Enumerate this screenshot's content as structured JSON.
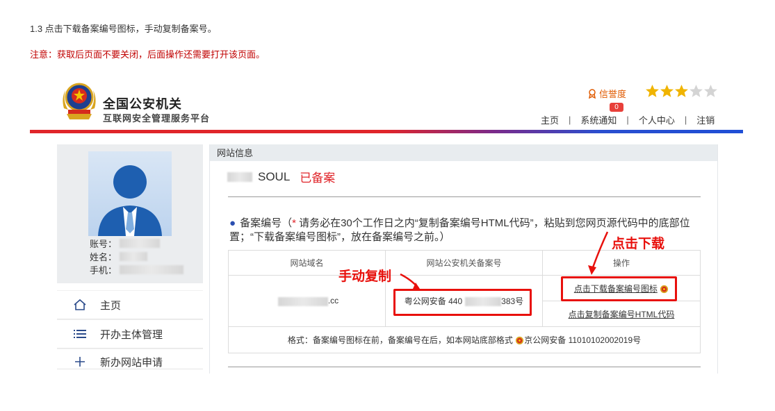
{
  "instructions": {
    "step": "1.3 点击下载备案编号图标，手动复制备案号。",
    "warning": "注意：获取后页面不要关闭，后面操作还需要打开该页面。"
  },
  "header": {
    "title": "全国公安机关",
    "subtitle": "互联网安全管理服务平台",
    "credit_label": "信誉度",
    "stars_filled": 3,
    "stars_total": 5,
    "notification_count": "0",
    "nav": [
      "主页",
      "系统通知",
      "个人中心",
      "注销"
    ]
  },
  "profile": {
    "account_label": "账号：",
    "name_label": "姓名：",
    "phone_label": "手机："
  },
  "menu": [
    {
      "label": "主页",
      "icon": "home-icon"
    },
    {
      "label": "开办主体管理",
      "icon": "list-icon"
    },
    {
      "label": "新办网站申请",
      "icon": "plus-icon"
    }
  ],
  "panel": {
    "header": "网站信息",
    "site_name": "SOUL",
    "site_status": "已备案",
    "record_label": "备案编号（",
    "record_note": " 请务必在30个工作日之内“复制备案编号HTML代码”，粘贴到您网页源代码中的底部位置；“下载备案编号图标”，放在备案编号之前。）",
    "table": {
      "headers": [
        "网站域名",
        "网站公安机关备案号",
        "操作"
      ],
      "domain_suffix": ".cc",
      "record_prefix": "粤公网安备 440",
      "record_suffix": "383号",
      "action_download": "点击下载备案编号图标",
      "action_copy": "点击复制备案编号HTML代码",
      "format_prefix": "格式：备案编号图标在前，备案编号在后，如本网站底部格式",
      "format_example": "京公网安备 11010102002019号"
    }
  },
  "annotations": {
    "manual_copy": "手动复制",
    "click_download": "点击下载"
  },
  "colors": {
    "accent_red": "#e0252a",
    "annotation_red": "#e8100c",
    "star_gold": "#f0b400"
  }
}
